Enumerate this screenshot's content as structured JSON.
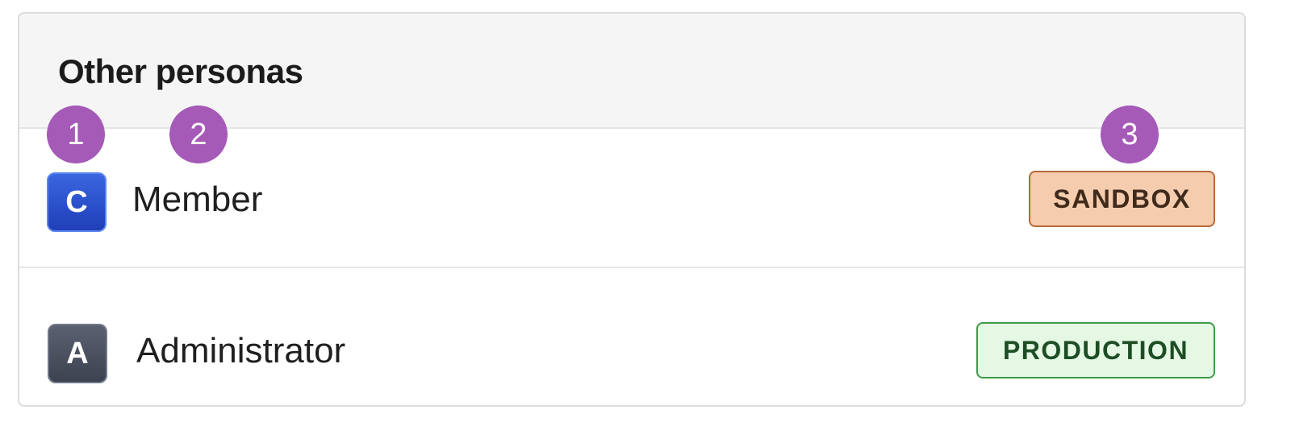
{
  "section": {
    "title": "Other personas"
  },
  "personas": [
    {
      "avatar_letter": "C",
      "avatar_color": "#2a4fd0",
      "name": "Member",
      "badge": {
        "label": "SANDBOX",
        "bg": "#f5ccad",
        "border": "#b56a3a"
      }
    },
    {
      "avatar_letter": "A",
      "avatar_color": "#474c5a",
      "name": "Administrator",
      "badge": {
        "label": "PRODUCTION",
        "bg": "#e4f8e4",
        "border": "#3e9a4a"
      }
    }
  ],
  "callouts": [
    "1",
    "2",
    "3"
  ],
  "colors": {
    "callout": "#a55ab8",
    "header_bg": "#f5f5f5"
  }
}
